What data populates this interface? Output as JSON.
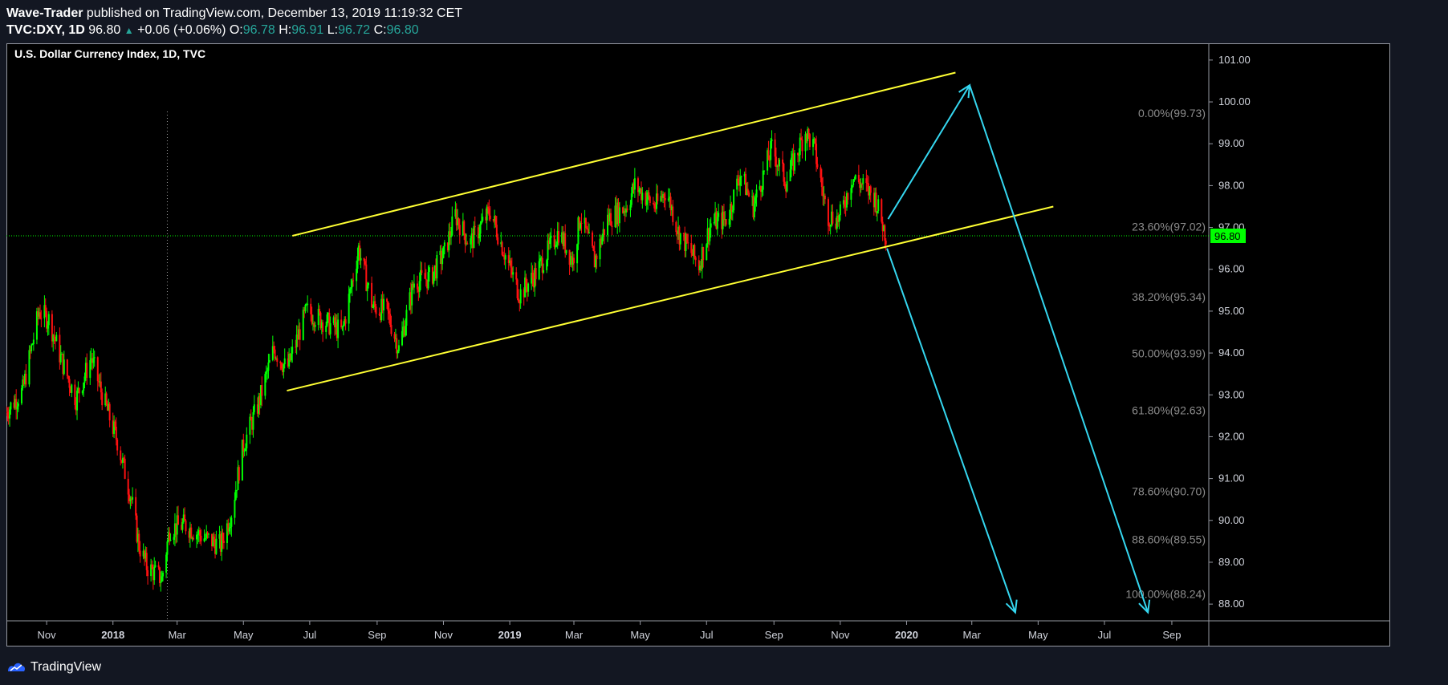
{
  "header": {
    "author": "Wave-Trader",
    "published_text": "published on TradingView.com, December 13, 2019 11:19:32 CET",
    "symbol": "TVC:DXY, 1D",
    "last": "96.80",
    "change": "+0.06 (+0.06%)",
    "o_label": "O:",
    "o_value": "96.78",
    "h_label": "H:",
    "h_value": "96.91",
    "l_label": "L:",
    "l_value": "96.72",
    "c_label": "C:",
    "c_value": "96.80"
  },
  "footer": {
    "brand": "TradingView"
  },
  "colors": {
    "up": "#00ff00",
    "down": "#ff1111",
    "channel": "#ffff33",
    "arrows": "#35d7f0",
    "last_price_bg": "#00ff00",
    "crosshair": "#999999",
    "fib_text": "#8c8c8c"
  },
  "chart_data": {
    "type": "candlestick",
    "title": "U.S. Dollar Currency Index, 1D, TVC",
    "y_axis": {
      "range": [
        87.6,
        101.4
      ],
      "ticks": [
        "101.00",
        "100.00",
        "99.00",
        "98.00",
        "97.00",
        "96.00",
        "95.00",
        "94.00",
        "93.00",
        "92.00",
        "91.00",
        "90.00",
        "89.00",
        "88.00"
      ]
    },
    "x_axis": {
      "range": [
        "2017-09-25",
        "2020-10-05"
      ],
      "ticks": [
        {
          "label": "Nov",
          "date": "2017-11-01"
        },
        {
          "label": "2018",
          "date": "2018-01-01"
        },
        {
          "label": "Mar",
          "date": "2018-03-01"
        },
        {
          "label": "May",
          "date": "2018-05-01"
        },
        {
          "label": "Jul",
          "date": "2018-07-01"
        },
        {
          "label": "Sep",
          "date": "2018-09-01"
        },
        {
          "label": "Nov",
          "date": "2018-11-01"
        },
        {
          "label": "2019",
          "date": "2019-01-01"
        },
        {
          "label": "Mar",
          "date": "2019-03-01"
        },
        {
          "label": "May",
          "date": "2019-05-01"
        },
        {
          "label": "Jul",
          "date": "2019-07-01"
        },
        {
          "label": "Sep",
          "date": "2019-09-01"
        },
        {
          "label": "Nov",
          "date": "2019-11-01"
        },
        {
          "label": "2020",
          "date": "2020-01-01"
        },
        {
          "label": "Mar",
          "date": "2020-03-01"
        },
        {
          "label": "May",
          "date": "2020-05-01"
        },
        {
          "label": "Jul",
          "date": "2020-07-01"
        },
        {
          "label": "Sep",
          "date": "2020-09-01"
        }
      ]
    },
    "price_path": [
      [
        "2017-09-25",
        92.6
      ],
      [
        "2017-10-10",
        93.1
      ],
      [
        "2017-10-25",
        95.0
      ],
      [
        "2017-11-03",
        94.8
      ],
      [
        "2017-11-15",
        93.8
      ],
      [
        "2017-11-28",
        92.9
      ],
      [
        "2017-12-12",
        93.9
      ],
      [
        "2017-12-22",
        93.0
      ],
      [
        "2018-01-05",
        91.9
      ],
      [
        "2018-01-18",
        90.5
      ],
      [
        "2018-01-25",
        89.4
      ],
      [
        "2018-02-01",
        88.9
      ],
      [
        "2018-02-15",
        88.6
      ],
      [
        "2018-02-22",
        89.8
      ],
      [
        "2018-03-08",
        89.9
      ],
      [
        "2018-03-25",
        89.6
      ],
      [
        "2018-04-10",
        89.4
      ],
      [
        "2018-04-20",
        90.2
      ],
      [
        "2018-05-01",
        91.8
      ],
      [
        "2018-05-15",
        92.8
      ],
      [
        "2018-05-29",
        94.1
      ],
      [
        "2018-06-10",
        93.6
      ],
      [
        "2018-06-28",
        95.0
      ],
      [
        "2018-07-18",
        94.7
      ],
      [
        "2018-07-31",
        94.5
      ],
      [
        "2018-08-15",
        96.5
      ],
      [
        "2018-08-28",
        95.1
      ],
      [
        "2018-09-10",
        95.0
      ],
      [
        "2018-09-21",
        94.1
      ],
      [
        "2018-10-05",
        95.7
      ],
      [
        "2018-10-20",
        95.8
      ],
      [
        "2018-11-02",
        96.4
      ],
      [
        "2018-11-12",
        97.3
      ],
      [
        "2018-11-25",
        96.6
      ],
      [
        "2018-12-14",
        97.4
      ],
      [
        "2018-12-31",
        96.1
      ],
      [
        "2019-01-10",
        95.4
      ],
      [
        "2019-01-25",
        95.9
      ],
      [
        "2019-02-15",
        96.9
      ],
      [
        "2019-02-28",
        96.2
      ],
      [
        "2019-03-07",
        97.3
      ],
      [
        "2019-03-20",
        96.2
      ],
      [
        "2019-04-01",
        97.2
      ],
      [
        "2019-04-18",
        97.5
      ],
      [
        "2019-04-26",
        98.0
      ],
      [
        "2019-05-15",
        97.5
      ],
      [
        "2019-05-25",
        97.9
      ],
      [
        "2019-06-05",
        96.9
      ],
      [
        "2019-06-24",
        96.1
      ],
      [
        "2019-07-05",
        97.1
      ],
      [
        "2019-07-20",
        97.2
      ],
      [
        "2019-08-01",
        98.3
      ],
      [
        "2019-08-13",
        97.5
      ],
      [
        "2019-08-30",
        98.9
      ],
      [
        "2019-09-12",
        98.1
      ],
      [
        "2019-09-30",
        99.3
      ],
      [
        "2019-10-08",
        98.9
      ],
      [
        "2019-10-20",
        97.3
      ],
      [
        "2019-10-31",
        97.2
      ],
      [
        "2019-11-12",
        98.2
      ],
      [
        "2019-11-22",
        98.0
      ],
      [
        "2019-12-03",
        97.7
      ],
      [
        "2019-12-13",
        96.8
      ]
    ],
    "last_price": "96.80",
    "channel_lines": [
      {
        "from": {
          "date": "2018-06-15",
          "price": 96.8
        },
        "to": {
          "date": "2020-02-15",
          "price": 100.7
        }
      },
      {
        "from": {
          "date": "2018-06-10",
          "price": 93.1
        },
        "to": {
          "date": "2020-05-15",
          "price": 97.5
        }
      }
    ],
    "projection_arrows": [
      {
        "from": {
          "date": "2019-12-15",
          "price": 97.2
        },
        "to": {
          "date": "2020-02-28",
          "price": 100.4
        }
      },
      {
        "from": {
          "date": "2020-02-28",
          "price": 100.4
        },
        "to": {
          "date": "2020-08-10",
          "price": 87.8
        }
      },
      {
        "from": {
          "date": "2019-12-14",
          "price": 96.5
        },
        "to": {
          "date": "2020-04-10",
          "price": 87.8
        }
      }
    ],
    "fib_levels": [
      {
        "label": "0.00%(99.73)",
        "price": 99.73
      },
      {
        "label": "23.60%(97.02)",
        "price": 97.02
      },
      {
        "label": "38.20%(95.34)",
        "price": 95.34
      },
      {
        "label": "50.00%(93.99)",
        "price": 93.99
      },
      {
        "label": "61.80%(92.63)",
        "price": 92.63
      },
      {
        "label": "78.60%(90.70)",
        "price": 90.7
      },
      {
        "label": "88.60%(89.55)",
        "price": 89.55
      },
      {
        "label": "100.00%(88.24)",
        "price": 88.24
      }
    ],
    "crosshair": {
      "date": "2018-02-20",
      "price": 96.8
    }
  }
}
